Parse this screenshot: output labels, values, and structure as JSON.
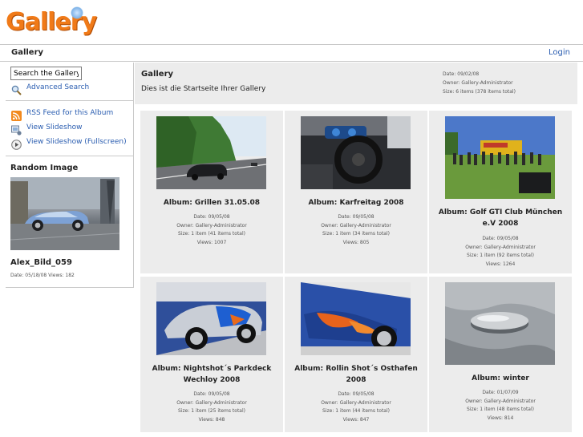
{
  "logo": {
    "text": "Gallery"
  },
  "topbar": {
    "breadcrumb": "Gallery",
    "login": "Login"
  },
  "sidebar": {
    "search_value": "Search the Gallery",
    "advanced_search": "Advanced Search",
    "rss": "RSS Feed for this Album",
    "slideshow": "View Slideshow",
    "slideshow_full": "View Slideshow (Fullscreen)",
    "random_title": "Random Image",
    "random_name": "Alex_Bild_059",
    "random_meta": "Date: 05/18/08 Views: 182"
  },
  "header": {
    "title": "Gallery",
    "description": "Dies ist die Startseite Ihrer Gallery",
    "date": "Date: 09/02/08",
    "owner": "Owner: Gallery-Administrator",
    "size": "Size: 6 items (378 items total)"
  },
  "albums": [
    {
      "title": "Album: Grillen 31.05.08",
      "date": "Date: 09/05/08",
      "owner": "Owner: Gallery-Administrator",
      "size": "Size: 1 item (41 items total)",
      "views": "Views: 1007"
    },
    {
      "title": "Album: Karfreitag 2008",
      "date": "Date: 09/05/08",
      "owner": "Owner: Gallery-Administrator",
      "size": "Size: 1 item (34 items total)",
      "views": "Views: 805"
    },
    {
      "title": "Album: Golf GTI Club München e.V 2008",
      "date": "Date: 09/05/08",
      "owner": "Owner: Gallery-Administrator",
      "size": "Size: 1 item (92 items total)",
      "views": "Views: 1264"
    },
    {
      "title": "Album: Nightshot´s Parkdeck Wechloy 2008",
      "date": "Date: 09/05/08",
      "owner": "Owner: Gallery-Administrator",
      "size": "Size: 1 item (25 items total)",
      "views": "Views: 848"
    },
    {
      "title": "Album: Rollin Shot´s Osthafen 2008",
      "date": "Date: 09/05/08",
      "owner": "Owner: Gallery-Administrator",
      "size": "Size: 1 item (44 items total)",
      "views": "Views: 847"
    },
    {
      "title": "Album: winter",
      "date": "Date: 01/07/09",
      "owner": "Owner: Gallery-Administrator",
      "size": "Size: 1 item (48 items total)",
      "views": "Views: 814"
    }
  ],
  "colors": {
    "link": "#2a5db0",
    "logo": "#f07a18",
    "panel": "#ececec",
    "border": "#c9c9c9"
  },
  "icons": [
    "search-icon",
    "rss-icon",
    "slideshow-icon",
    "play-icon"
  ]
}
